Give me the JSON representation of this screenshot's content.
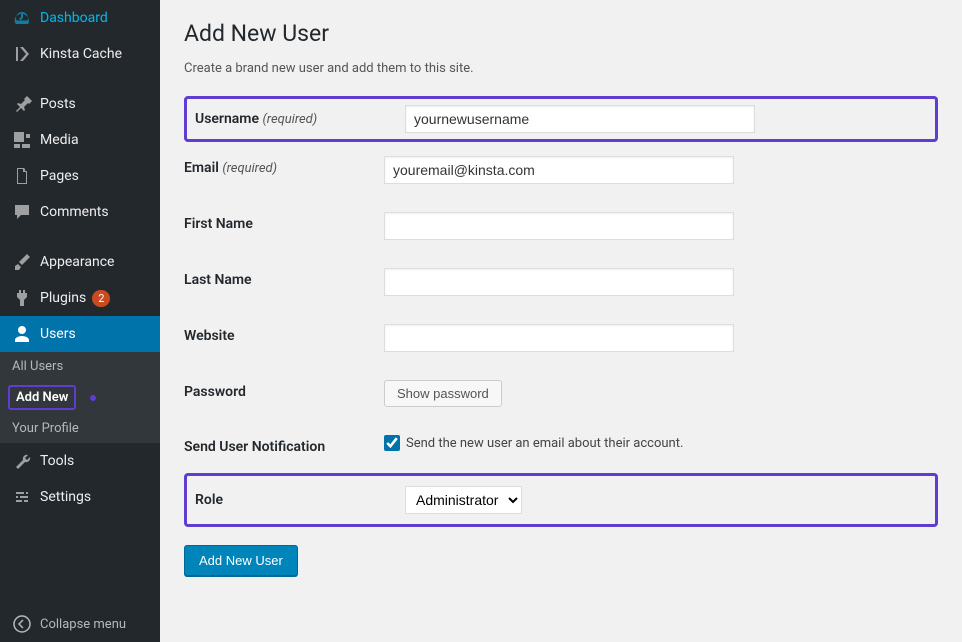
{
  "sidebar": {
    "dashboard": "Dashboard",
    "kinsta": "Kinsta Cache",
    "posts": "Posts",
    "media": "Media",
    "pages": "Pages",
    "comments": "Comments",
    "appearance": "Appearance",
    "plugins": "Plugins",
    "plugins_badge": "2",
    "users": "Users",
    "tools": "Tools",
    "settings": "Settings",
    "collapse": "Collapse menu"
  },
  "submenu": {
    "all_users": "All Users",
    "add_new": "Add New",
    "your_profile": "Your Profile"
  },
  "page": {
    "title": "Add New User",
    "subtitle": "Create a brand new user and add them to this site.",
    "labels": {
      "username": "Username",
      "email": "Email",
      "first_name": "First Name",
      "last_name": "Last Name",
      "website": "Website",
      "password": "Password",
      "send_notification": "Send User Notification",
      "role": "Role",
      "required": "(required)"
    },
    "values": {
      "username": "yournewusername",
      "email": "youremail@kinsta.com",
      "first_name": "",
      "last_name": "",
      "website": "",
      "role": "Administrator"
    },
    "show_password": "Show password",
    "notification_text": "Send the new user an email about their account.",
    "submit": "Add New User"
  }
}
